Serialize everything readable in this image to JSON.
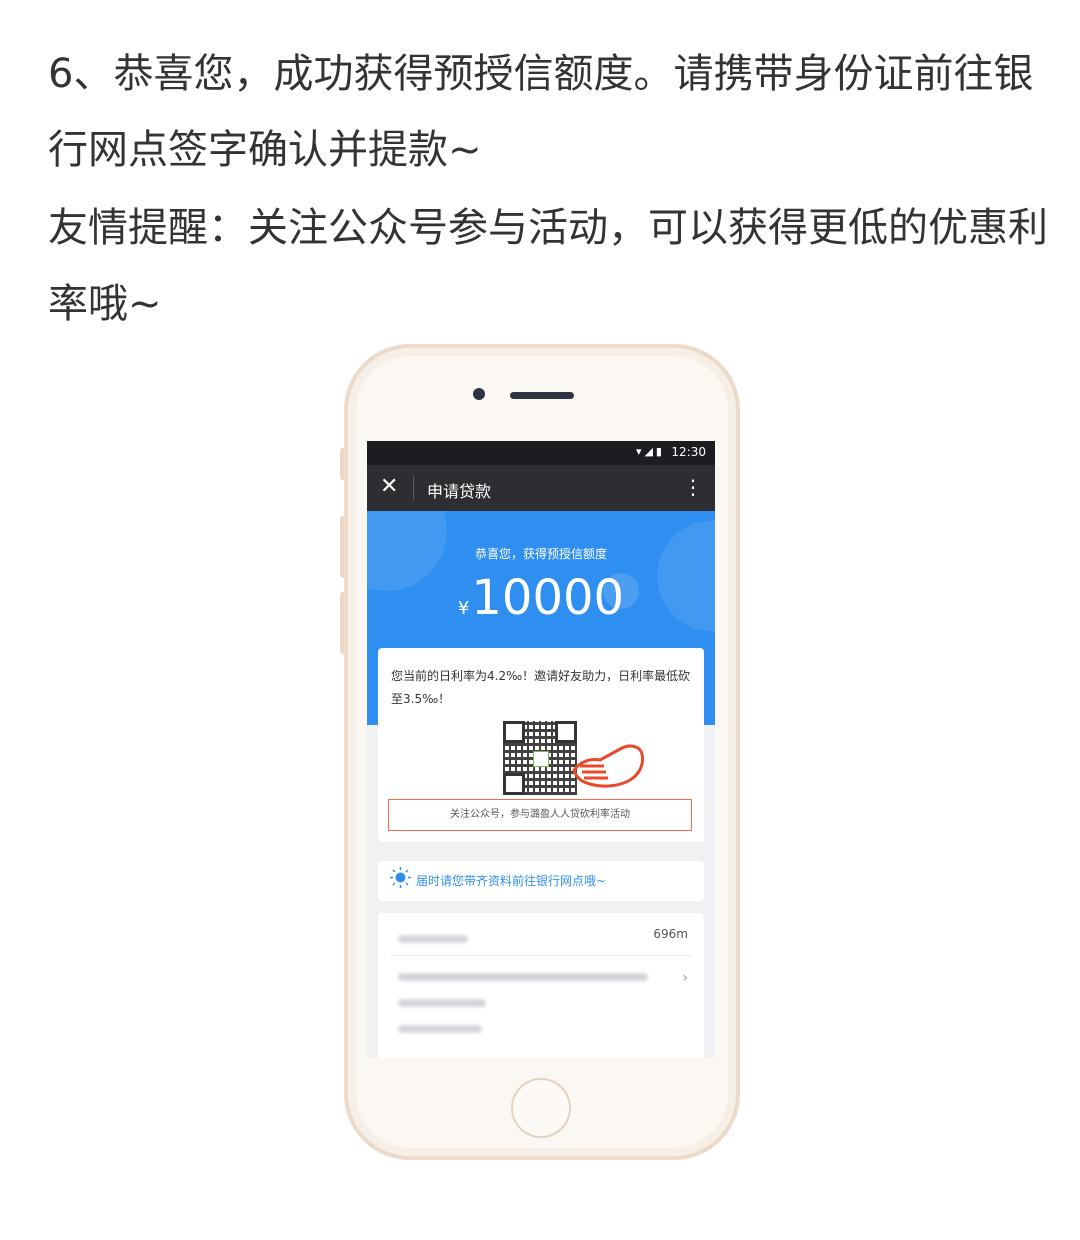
{
  "instructions": {
    "step_text": "6、恭喜您，成功获得预授信额度。请携带身份证前往银行网点签字确认并提款~",
    "tip_text": "友情提醒：关注公众号参与活动，可以获得更低的优惠利率哦~"
  },
  "phone": {
    "status_bar": {
      "time": "12:30"
    },
    "nav": {
      "close_glyph": "✕",
      "title": "申请贷款",
      "more_glyph": "⋮"
    },
    "banner": {
      "subtitle": "恭喜您，获得预授信额度",
      "currency_symbol": "¥",
      "amount": "10000"
    },
    "rate_card": {
      "text": "您当前的日利率为4.2‰！邀请好友助力，日利率最低砍至3.5‰！",
      "follow_button_label": "关注公众号，参与潞盈人人贷砍利率活动"
    },
    "reminder": {
      "text": "届时请您带齐资料前往银行网点哦~"
    },
    "branch_card": {
      "distance": "696m"
    }
  },
  "colors": {
    "accent_blue": "#2f8ff0",
    "button_border": "#f36c4f",
    "phone_frame": "#ecd9c8"
  }
}
